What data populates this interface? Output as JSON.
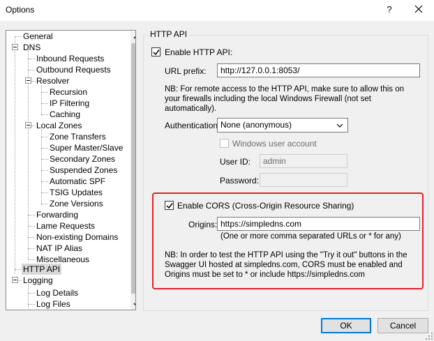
{
  "window": {
    "title": "Options",
    "help_glyph": "?"
  },
  "tree": {
    "items": [
      {
        "label": "General"
      },
      {
        "label": "DNS"
      },
      {
        "label": "Inbound Requests"
      },
      {
        "label": "Outbound Requests"
      },
      {
        "label": "Resolver"
      },
      {
        "label": "Recursion"
      },
      {
        "label": "IP Filtering"
      },
      {
        "label": "Caching"
      },
      {
        "label": "Local Zones"
      },
      {
        "label": "Zone Transfers"
      },
      {
        "label": "Super Master/Slave"
      },
      {
        "label": "Secondary Zones"
      },
      {
        "label": "Suspended Zones"
      },
      {
        "label": "Automatic SPF"
      },
      {
        "label": "TSIG Updates"
      },
      {
        "label": "Zone Versions"
      },
      {
        "label": "Forwarding"
      },
      {
        "label": "Lame Requests"
      },
      {
        "label": "Non-existing Domains"
      },
      {
        "label": "NAT IP Alias"
      },
      {
        "label": "Miscellaneous"
      },
      {
        "label": "HTTP API",
        "selected": true
      },
      {
        "label": "Logging"
      },
      {
        "label": "Log Details"
      },
      {
        "label": "Log Files"
      }
    ]
  },
  "http_api": {
    "group_title": "HTTP API",
    "enable_label": "Enable HTTP API:",
    "enable_checked": true,
    "url_prefix_label": "URL prefix:",
    "url_prefix_value": "http://127.0.0.1:8053/",
    "note": "NB: For remote access to the HTTP API, make sure to allow this on your firewalls including the local Windows Firewall (not set automatically).",
    "auth_label": "Authentication:",
    "auth_value": "None (anonymous)",
    "windows_user_label": "Windows user account",
    "windows_user_checked": false,
    "userid_label": "User ID:",
    "userid_value": "admin",
    "password_label": "Password:",
    "password_value": ""
  },
  "cors": {
    "enable_label": "Enable CORS (Cross-Origin Resource Sharing)",
    "enable_checked": true,
    "origins_label": "Origins:",
    "origins_value": "https://simpledns.com",
    "origins_hint": "(One or more comma separated URLs or * for any)",
    "note": "NB: In order to test the HTTP API using the \"Try it out\" buttons in the Swagger UI hosted at simpledns.com, CORS must be enabled and Origins must be set to * or include https://simpledns.com",
    "highlight_color": "#e0202a"
  },
  "buttons": {
    "ok": "OK",
    "cancel": "Cancel"
  },
  "colors": {
    "accent": "#0078d7"
  }
}
